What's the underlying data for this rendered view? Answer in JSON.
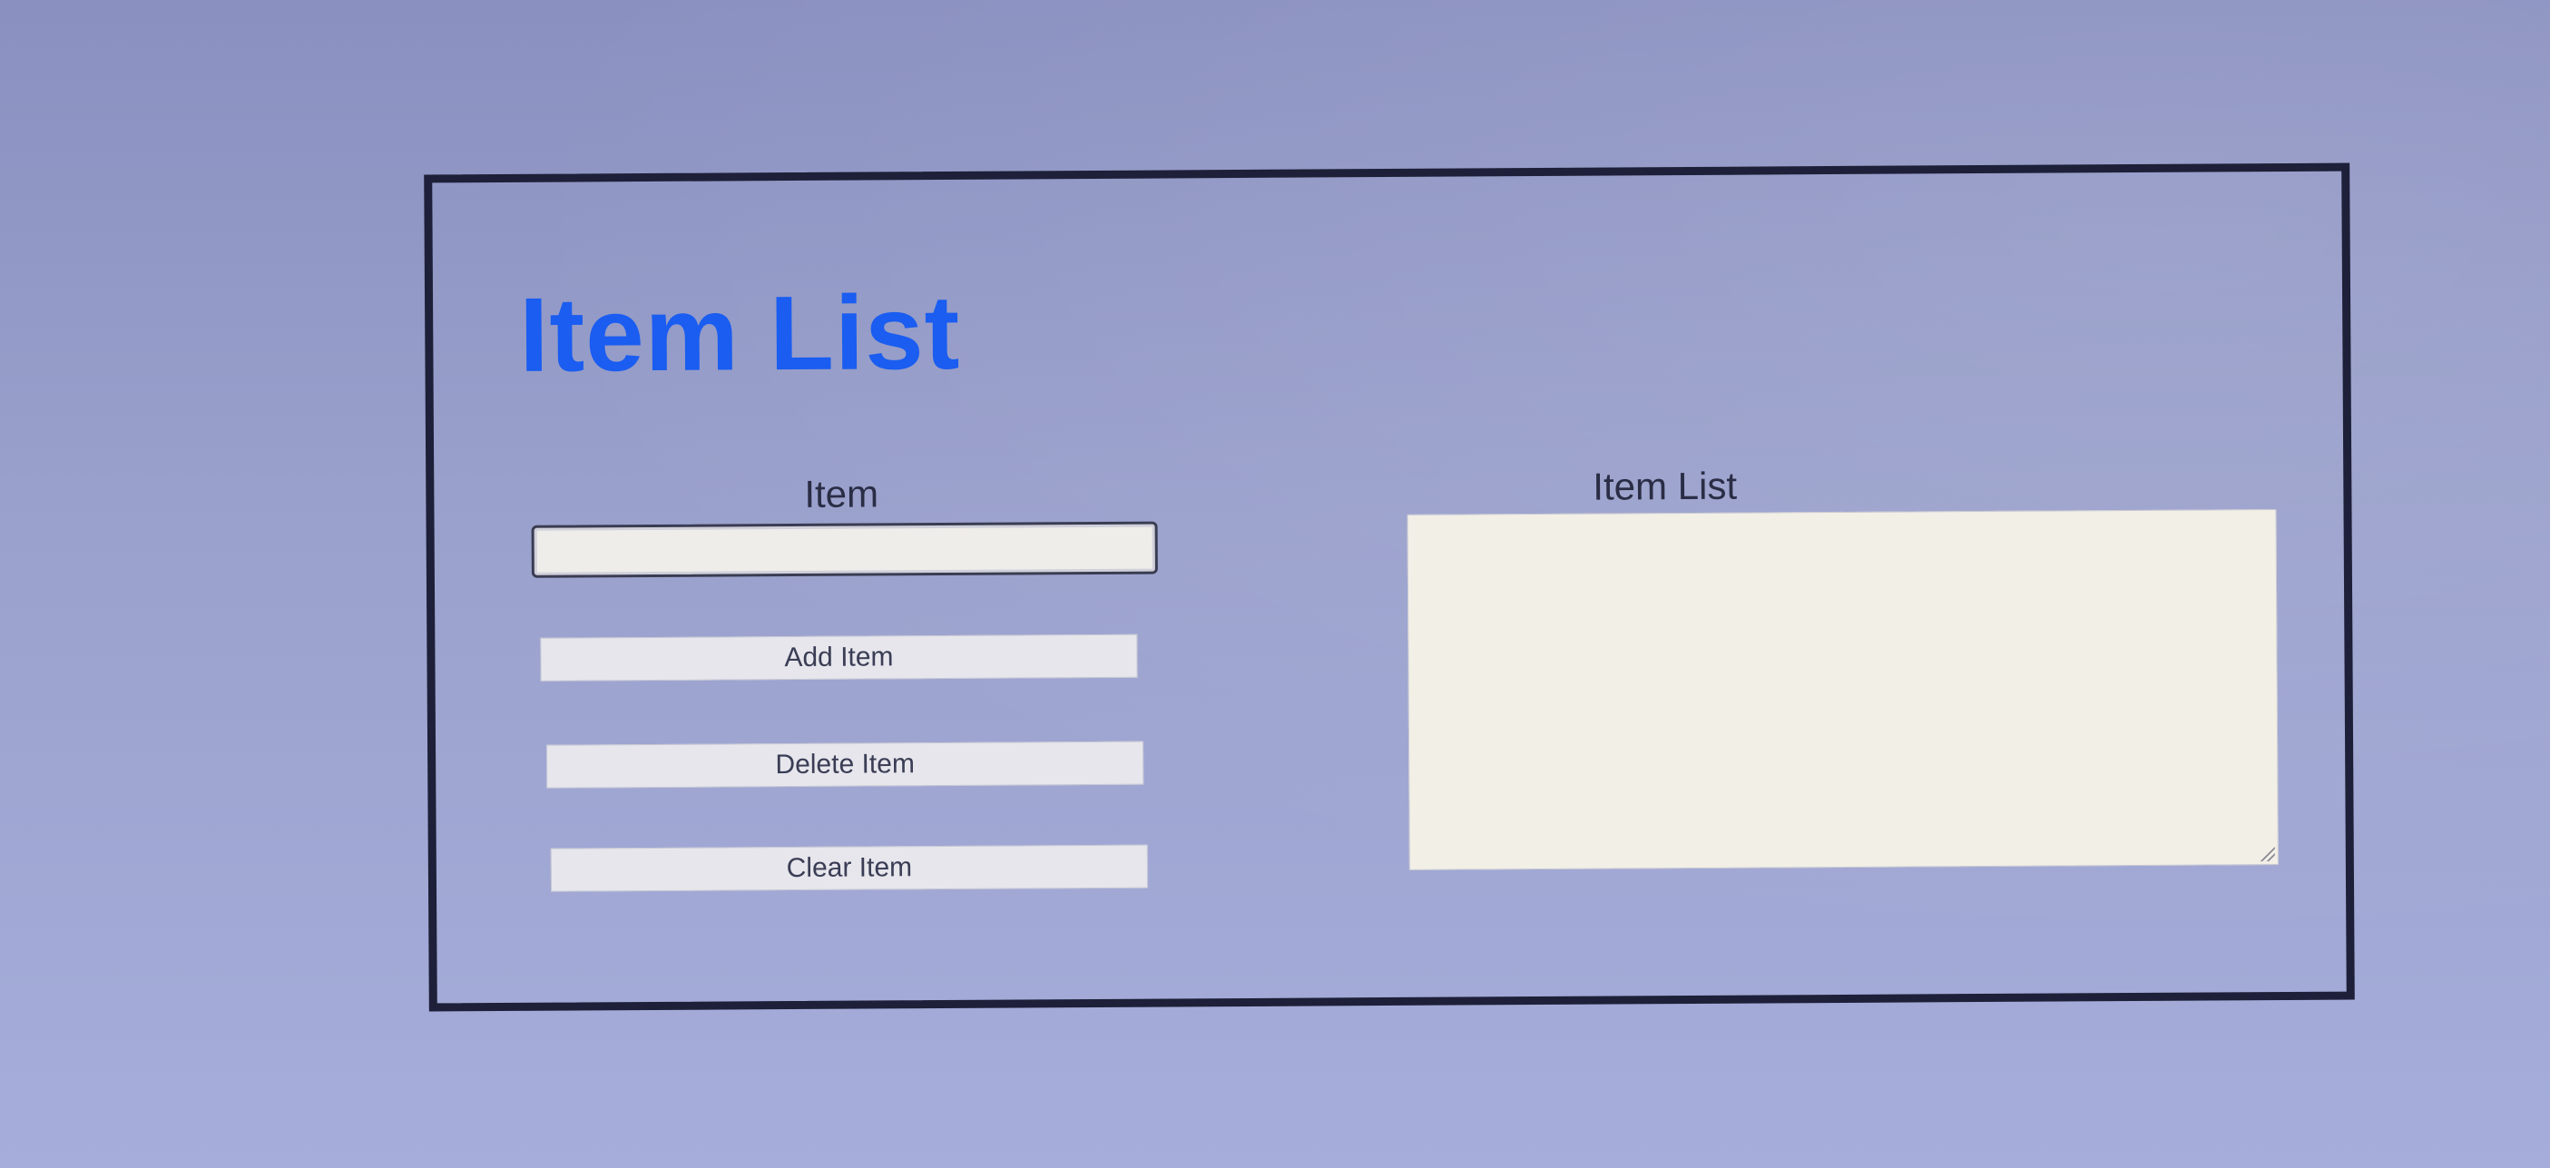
{
  "app": {
    "title": "Item List"
  },
  "form": {
    "item_label": "Item",
    "item_value": "",
    "buttons": {
      "add": "Add Item",
      "delete": "Delete Item",
      "clear": "Clear Item"
    }
  },
  "list": {
    "label": "Item List",
    "items": []
  },
  "colors": {
    "title": "#1a5df0",
    "background": "#9aa1cc",
    "panel_border": "#1d2038",
    "list_background": "#f2efe7"
  }
}
